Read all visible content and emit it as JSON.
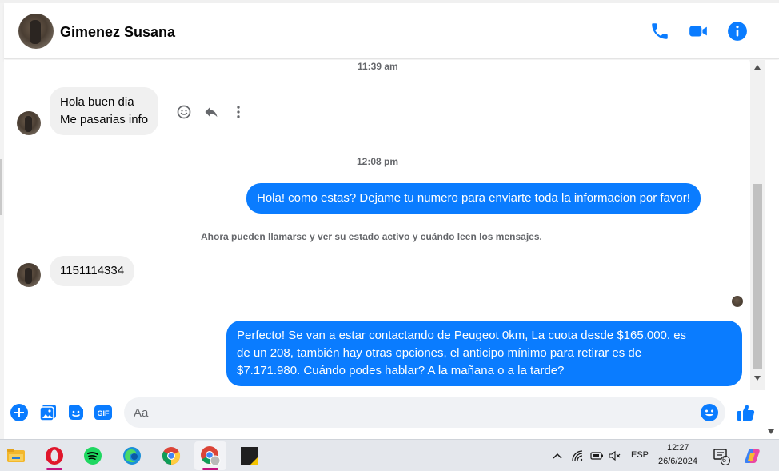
{
  "header": {
    "contact_name": "Gimenez Susana",
    "icons": [
      "phone-icon",
      "video-call-icon",
      "info-icon"
    ]
  },
  "conversation": {
    "timestamp_1": "11:39 am",
    "incoming_1": {
      "line1": "Hola buen dia",
      "line2": "Me pasarias info"
    },
    "timestamp_2": "12:08 pm",
    "outgoing_1": "Hola! como estas? Dejame tu numero para enviarte toda la informacion por favor!",
    "system_notice": "Ahora pueden llamarse y ver su estado activo y cuándo leen los mensajes.",
    "incoming_2": "1151114334",
    "outgoing_2": {
      "line1": "Perfecto!  Se van a estar contactando de Peugeot 0km, La cuota desde $165.000. es",
      "line2": "de un 208, también hay otras opciones, el anticipo mínimo para retirar es de",
      "line3": "$7.171.980. Cuándo podes hablar? A la mañana o a la tarde?"
    }
  },
  "composer": {
    "placeholder": "Aa",
    "icons": [
      "add-icon",
      "photo-icon",
      "sticker-icon",
      "gif-icon",
      "emoji-icon",
      "like-icon"
    ],
    "gif_label": "GIF"
  },
  "taskbar": {
    "apps": [
      "file-explorer-icon",
      "opera-icon",
      "spotify-icon",
      "edge-icon",
      "chrome-icon",
      "chrome-profile-icon",
      "sticky-app-icon"
    ],
    "language": "ESP",
    "time": "12:27",
    "date": "26/6/2024",
    "notification_count": "6"
  },
  "colors": {
    "accent": "#0a7cff",
    "bubble_incoming": "#f0f0f0",
    "text_secondary": "#65676b"
  }
}
